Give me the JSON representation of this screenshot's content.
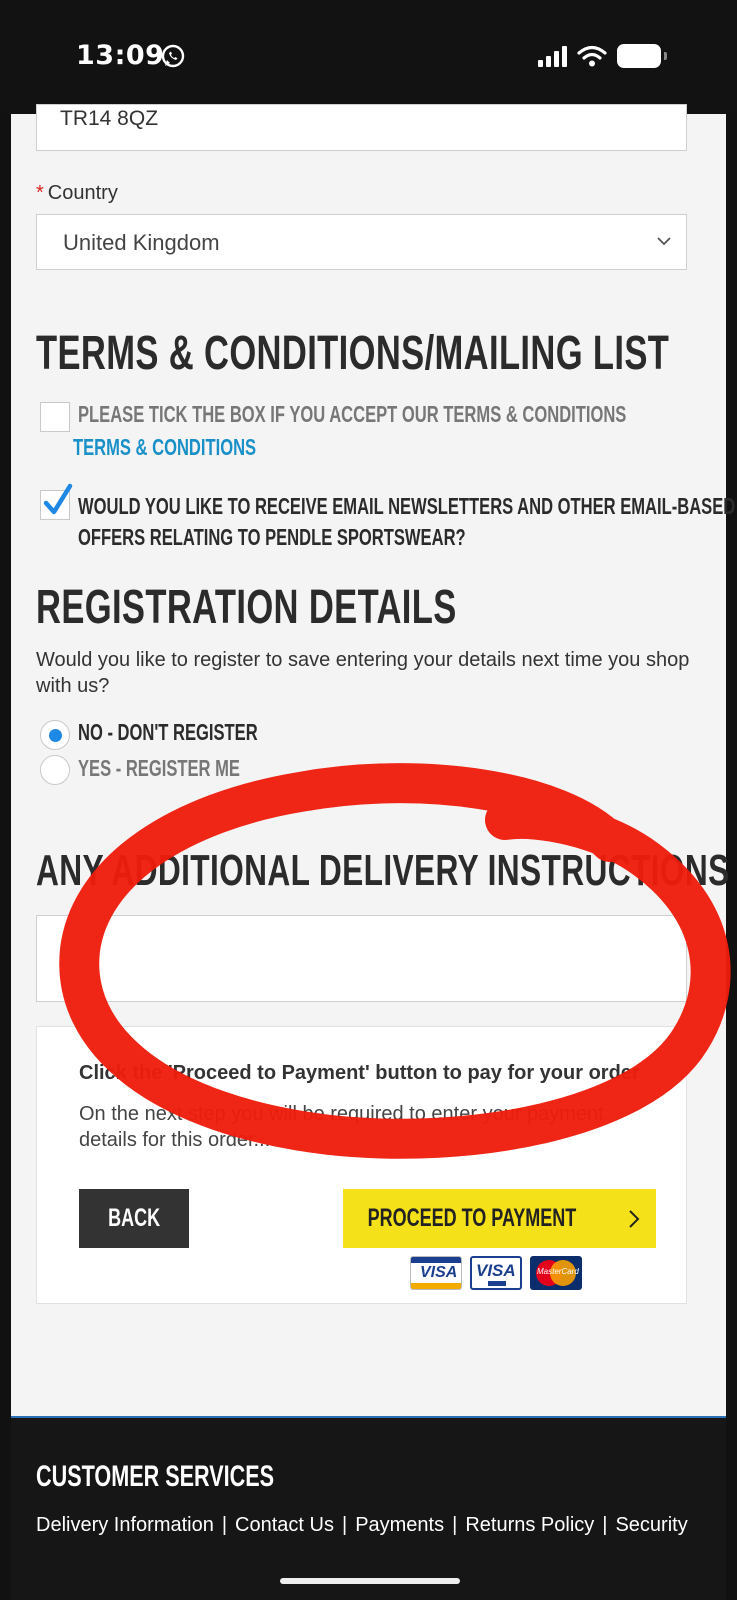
{
  "status_bar": {
    "time": "13:09"
  },
  "address": {
    "postcode_value": "TR14 8QZ"
  },
  "country": {
    "required_mark": "*",
    "label": "Country",
    "selected": "United Kingdom"
  },
  "terms_section": {
    "heading": "TERMS & CONDITIONS/MAILING LIST",
    "accept_text": "PLEASE TICK THE BOX IF YOU ACCEPT OUR TERMS & CONDITIONS",
    "accept_checked": false,
    "terms_link": "TERMS & CONDITIONS",
    "newsletter_line1": "WOULD YOU LIKE TO RECEIVE EMAIL NEWSLETTERS AND OTHER EMAIL-BASED",
    "newsletter_line2": "OFFERS RELATING TO PENDLE SPORTSWEAR?",
    "newsletter_checked": true
  },
  "registration": {
    "heading": "REGISTRATION DETAILS",
    "question": "Would you like to register to save entering your details next time you shop with us?",
    "options": [
      {
        "label": "NO - DON'T REGISTER",
        "selected": true
      },
      {
        "label": "YES - REGISTER ME",
        "selected": false
      }
    ]
  },
  "delivery": {
    "heading": "ANY ADDITIONAL DELIVERY INSTRUCTIONS",
    "value": ""
  },
  "payment_panel": {
    "title": "Click the 'Proceed to Payment' button to pay for your order",
    "text": "On the next step you will be required to enter your payment details for this order...",
    "back_label": "BACK",
    "proceed_label": "PROCEED TO PAYMENT",
    "cards": [
      "VISA",
      "VISA",
      "MasterCard"
    ]
  },
  "footer": {
    "title": "CUSTOMER SERVICES",
    "links": [
      "Delivery Information",
      "Contact Us",
      "Payments",
      "Returns Policy",
      "Security"
    ],
    "separator": "|"
  },
  "annotation": {
    "color": "#ee1c0c"
  },
  "colors": {
    "accent_yellow": "#f5e11a",
    "link_blue": "#1a90c8",
    "radio_blue": "#1e88e5",
    "required_red": "#d9261c"
  }
}
